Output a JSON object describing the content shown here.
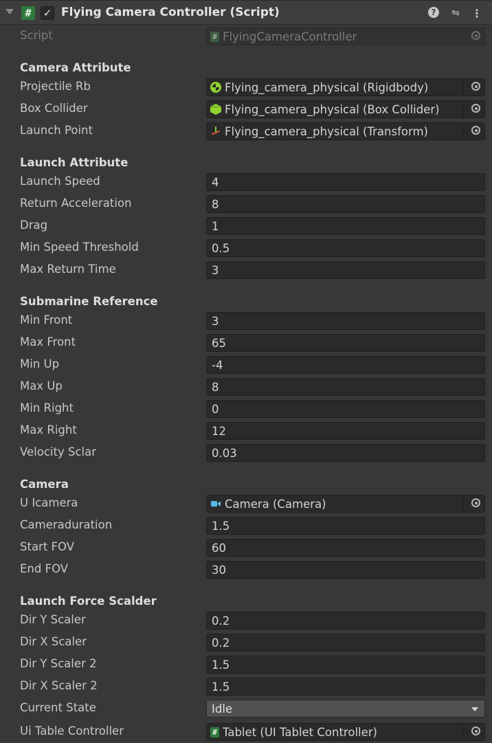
{
  "header": {
    "title": "Flying Camera Controller (Script)",
    "enabled_check": "✓",
    "script_glyph": "#",
    "help_glyph": "?",
    "settings_glyph": "⇋",
    "more_glyph": "⋮"
  },
  "script_row": {
    "label": "Script",
    "value": "FlyingCameraController"
  },
  "camera_attribute": {
    "header": "Camera Attribute",
    "projectile_rb": {
      "label": "Projectile Rb",
      "value": "Flying_camera_physical (Rigidbody)",
      "icon": "rigidbody-icon"
    },
    "box_collider": {
      "label": "Box Collider",
      "value": "Flying_camera_physical (Box Collider)",
      "icon": "box-collider-icon"
    },
    "launch_point": {
      "label": "Launch Point",
      "value": "Flying_camera_physical (Transform)",
      "icon": "transform-icon"
    }
  },
  "launch_attribute": {
    "header": "Launch Attribute",
    "fields": [
      {
        "label": "Launch Speed",
        "value": "4"
      },
      {
        "label": "Return Acceleration",
        "value": "8"
      },
      {
        "label": "Drag",
        "value": "1"
      },
      {
        "label": "Min Speed Threshold",
        "value": "0.5"
      },
      {
        "label": "Max Return Time",
        "value": "3"
      }
    ]
  },
  "submarine_reference": {
    "header": "Submarine Reference",
    "fields": [
      {
        "label": "Min Front",
        "value": "3"
      },
      {
        "label": "Max Front",
        "value": "65"
      },
      {
        "label": "Min Up",
        "value": "-4"
      },
      {
        "label": "Max Up",
        "value": "8"
      },
      {
        "label": "Min Right",
        "value": "0"
      },
      {
        "label": "Max Right",
        "value": "12"
      },
      {
        "label": "Velocity Sclar",
        "value": "0.03"
      }
    ]
  },
  "camera": {
    "header": "Camera",
    "u_icamera": {
      "label": "U Icamera",
      "value": "Camera (Camera)",
      "icon": "camera-icon"
    },
    "fields": [
      {
        "label": "Cameraduration",
        "value": "1.5"
      },
      {
        "label": "Start FOV",
        "value": "60"
      },
      {
        "label": "End FOV",
        "value": "30"
      }
    ]
  },
  "launch_force_scalder": {
    "header": "Launch Force Scalder",
    "fields": [
      {
        "label": "Dir Y Scaler",
        "value": "0.2"
      },
      {
        "label": "Dir X Scaler",
        "value": "0.2"
      },
      {
        "label": "Dir Y Scaler 2",
        "value": "1.5"
      },
      {
        "label": "Dir X Scaler 2",
        "value": "1.5"
      }
    ],
    "current_state": {
      "label": "Current State",
      "value": "Idle"
    },
    "ui_table_controller": {
      "label": "Ui Table Controller",
      "value": "Tablet (UI Tablet Controller)",
      "icon": "script-icon"
    }
  }
}
